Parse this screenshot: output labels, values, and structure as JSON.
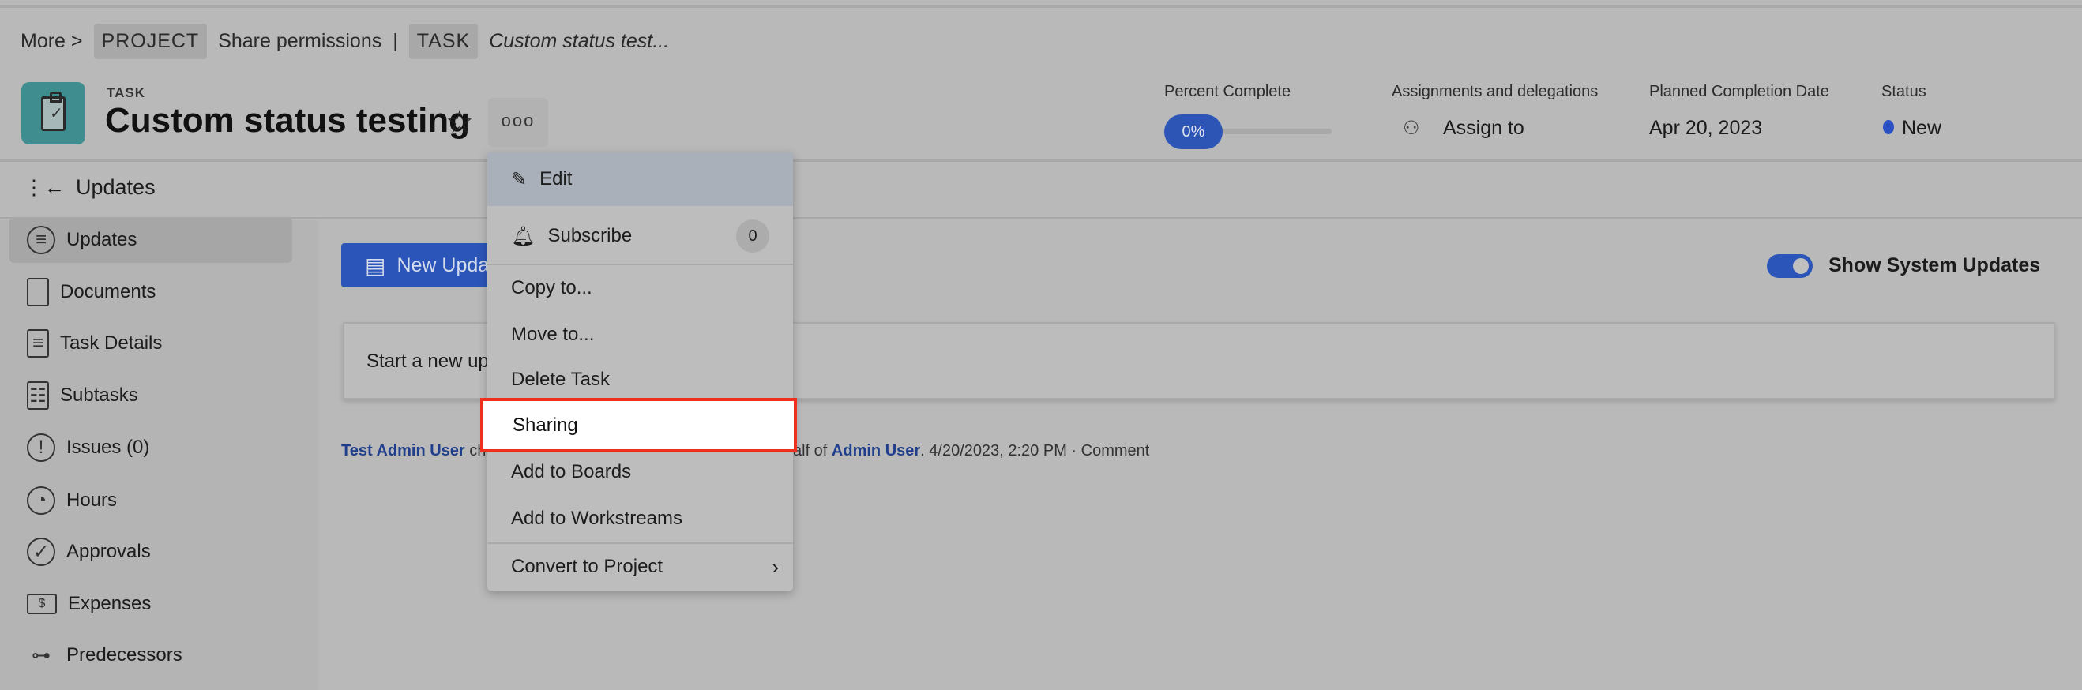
{
  "breadcrumb": {
    "more": "More >",
    "project_chip": "PROJECT",
    "project_name": "Share permissions",
    "sep": "|",
    "task_chip": "TASK",
    "task_name": "Custom status test..."
  },
  "header": {
    "type": "TASK",
    "title": "Custom status testing",
    "more": "ooo",
    "percent": {
      "label": "Percent Complete",
      "value": "0%",
      "fraction": 0
    },
    "assign": {
      "label": "Assignments and delegations",
      "value": "Assign to"
    },
    "planned": {
      "label": "Planned Completion Date",
      "value": "Apr 20, 2023"
    },
    "status": {
      "label": "Status",
      "value": "New",
      "color": "#2b4fc4"
    }
  },
  "panel_title": "Updates",
  "sidebar": {
    "items": [
      {
        "label": "Updates",
        "icon": "chat-bubble-icon"
      },
      {
        "label": "Documents",
        "icon": "document-icon"
      },
      {
        "label": "Task Details",
        "icon": "details-icon"
      },
      {
        "label": "Subtasks",
        "icon": "clipboard-list-icon"
      },
      {
        "label": "Issues (0)",
        "icon": "exclamation-icon"
      },
      {
        "label": "Hours",
        "icon": "clock-icon"
      },
      {
        "label": "Approvals",
        "icon": "check-circle-icon"
      },
      {
        "label": "Expenses",
        "icon": "money-icon"
      },
      {
        "label": "Predecessors",
        "icon": "predecessor-icon"
      }
    ]
  },
  "main": {
    "new_update": "New Update",
    "show_system": "Show System Updates",
    "start_placeholder": "Start a new update",
    "activity": {
      "user": "Test Admin User",
      "mid_left": "ch",
      "mid_right": "alf of",
      "target": "Admin User",
      "time": ". 4/20/2023, 2:20 PM · ",
      "comment": "Comment"
    }
  },
  "menu": {
    "edit": "Edit",
    "subscribe": "Subscribe",
    "subscribe_count": "0",
    "copy": "Copy to...",
    "move": "Move to...",
    "delete": "Delete Task",
    "sharing": "Sharing",
    "boards": "Add to Boards",
    "workstreams": "Add to Workstreams",
    "convert": "Convert to Project"
  },
  "colors": {
    "accent": "#2b55b8",
    "highlight_border": "#f0301e",
    "teal": "#3f8d8e"
  }
}
